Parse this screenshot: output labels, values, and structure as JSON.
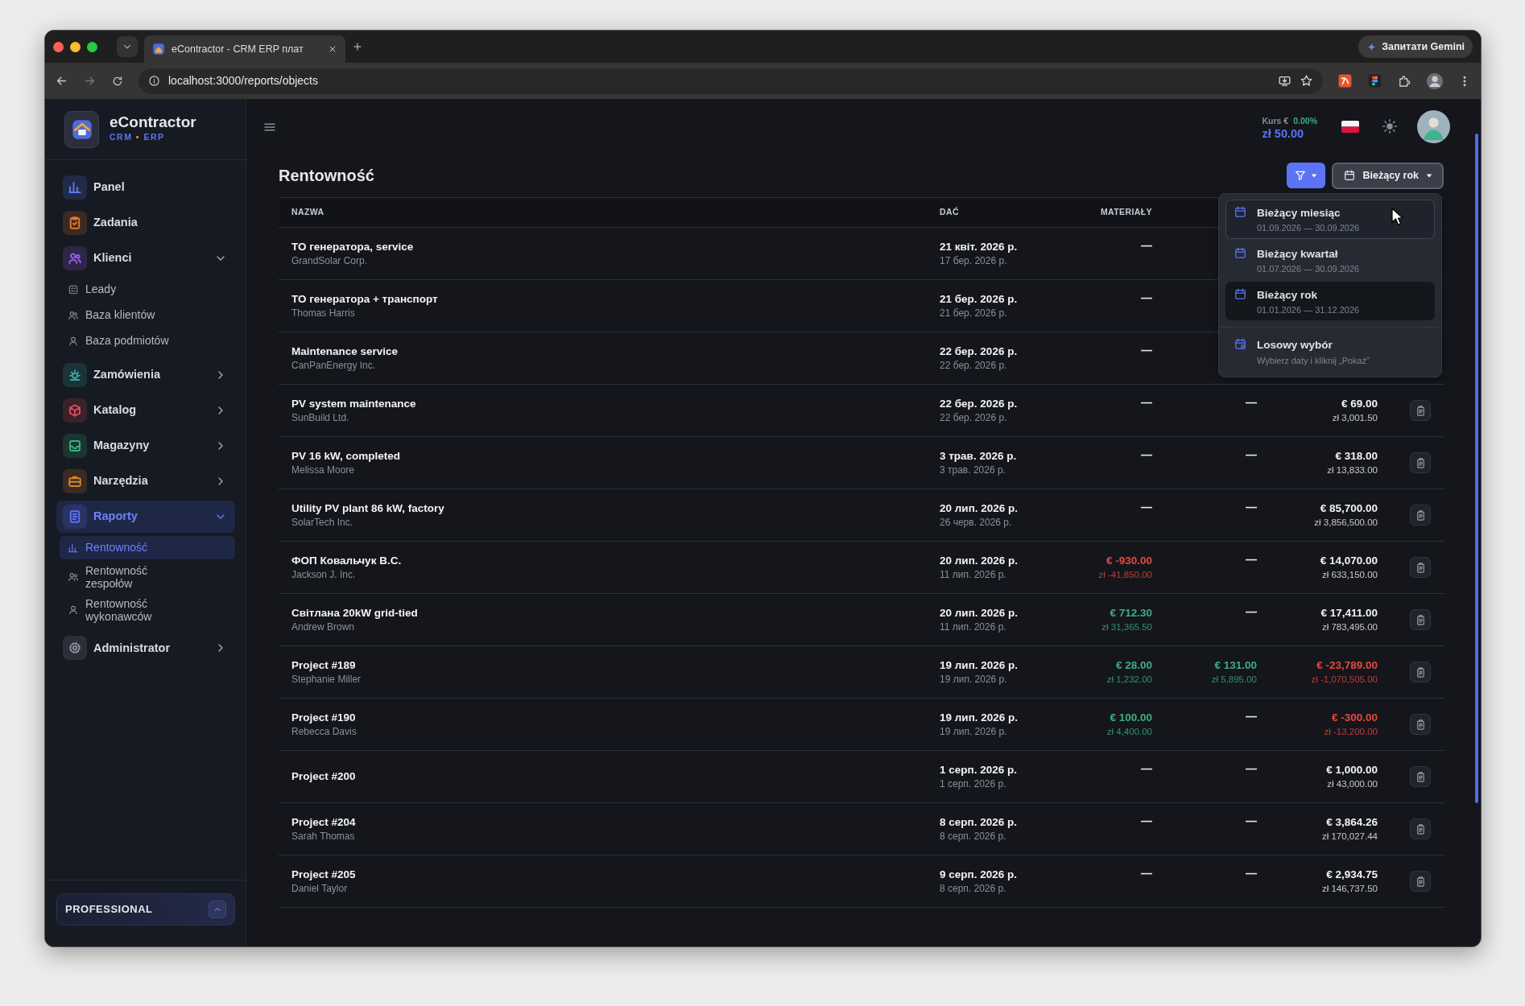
{
  "browser": {
    "tab_title": "eContractor - CRM ERP плат",
    "address": "localhost:3000/reports/objects",
    "gemini": "Запитати Gemini"
  },
  "brand": {
    "name": "eContractor",
    "tagline": [
      "CRM",
      "•",
      "ERP"
    ]
  },
  "sidebar": {
    "items": [
      {
        "label": "Panel",
        "kind": "link",
        "selected": false,
        "color": "#5b74f5"
      },
      {
        "label": "Zadania",
        "kind": "link",
        "selected": false,
        "color": "#e5762f"
      },
      {
        "label": "Klienci",
        "kind": "group",
        "expanded": true,
        "selected": false,
        "color": "#9a5cf0",
        "children": [
          {
            "label": "Leady",
            "selected": false
          },
          {
            "label": "Baza klientów",
            "selected": false
          },
          {
            "label": "Baza podmiotów",
            "selected": false
          }
        ]
      },
      {
        "label": "Zamówienia",
        "kind": "group",
        "expanded": false,
        "selected": false,
        "color": "#3aa6a6"
      },
      {
        "label": "Katalog",
        "kind": "group",
        "expanded": false,
        "selected": false,
        "color": "#e0485a"
      },
      {
        "label": "Magazyny",
        "kind": "group",
        "expanded": false,
        "selected": false,
        "color": "#35b27a"
      },
      {
        "label": "Narzędzia",
        "kind": "group",
        "expanded": false,
        "selected": false,
        "color": "#d9822b"
      },
      {
        "label": "Raporty",
        "kind": "group",
        "expanded": true,
        "selected": true,
        "color": "#5b74f5",
        "children": [
          {
            "label": "Rentowność",
            "selected": true
          },
          {
            "label": "Rentowność zespołów",
            "selected": false
          },
          {
            "label": "Rentowność wykonawców",
            "selected": false
          }
        ]
      },
      {
        "label": "Administrator",
        "kind": "group",
        "expanded": false,
        "selected": false,
        "color": "#8a8f9c"
      }
    ],
    "plan": "PROFESSIONAL"
  },
  "header": {
    "rate_label": "Kurs €",
    "rate_change": "0.00%",
    "rate_value": "zł 50.00"
  },
  "page": {
    "title": "Rentowność",
    "period_button": "Bieżący rok"
  },
  "period_menu": [
    {
      "label": "Bieżący miesiąc",
      "range": "01.09.2026 — 30.09.2026",
      "selected": false,
      "hovered": true
    },
    {
      "label": "Bieżący kwartał",
      "range": "01.07.2026 — 30.09.2026",
      "selected": false,
      "hovered": false
    },
    {
      "label": "Bieżący rok",
      "range": "01.01.2026 — 31.12.2026",
      "selected": true,
      "hovered": false
    },
    {
      "label": "Losowy wybór",
      "range": "Wybierz daty i kliknij „Pokaż”",
      "selected": false,
      "hovered": false,
      "divider_before": true
    }
  ],
  "table": {
    "columns": [
      "NAZWA",
      "DAĆ",
      "MATERIAŁY"
    ],
    "rows": [
      {
        "name": "ТО генератора, service",
        "client": "GrandSolar Corp.",
        "date": "21 квіт. 2026 р.",
        "date_2": "17 бер. 2026 р.",
        "materials": {
          "kind": "dash",
          "text": "—"
        },
        "report_button": false
      },
      {
        "name": "ТО генератора + транспорт",
        "client": "Thomas Harris",
        "date": "21 бер. 2026 р.",
        "date_2": "21 бер. 2026 р.",
        "materials": {
          "kind": "dash",
          "text": "—"
        },
        "report_button": false
      },
      {
        "name": "Maintenance service",
        "client": "CanPanEnergy Inc.",
        "date": "22 бер. 2026 р.",
        "date_2": "22 бер. 2026 р.",
        "materials": {
          "kind": "dash",
          "text": "—"
        },
        "report_button": false
      },
      {
        "name": "PV system maintenance",
        "client": "SunBuild Ltd.",
        "date": "22 бер. 2026 р.",
        "date_2": "22 бер. 2026 р.",
        "materials": {
          "kind": "dash",
          "text": "—"
        },
        "column_4": {
          "kind": "dash",
          "text": "—"
        },
        "column_5": {
          "kind": "amount",
          "eur": "€ 69.00",
          "pln": "zł 3,001.50",
          "color": "#f0f2f5"
        },
        "report_button": true
      },
      {
        "name": "PV 16 kW, completed",
        "client": "Melissa Moore",
        "date": "3 трав. 2026 р.",
        "date_2": "3 трав. 2026 р.",
        "materials": {
          "kind": "dash",
          "text": "—"
        },
        "column_4": {
          "kind": "dash",
          "text": "—"
        },
        "column_5": {
          "kind": "amount",
          "eur": "€ 318.00",
          "pln": "zł 13,833.00",
          "color": "#f0f2f5"
        },
        "report_button": true
      },
      {
        "name": "Utility PV plant 86 kW, factory",
        "client": "SolarTech Inc.",
        "date": "20 лип. 2026 р.",
        "date_2": "26 черв. 2026 р.",
        "materials": {
          "kind": "dash",
          "text": "—"
        },
        "column_4": {
          "kind": "dash",
          "text": "—"
        },
        "column_5": {
          "kind": "amount",
          "eur": "€ 85,700.00",
          "pln": "zł 3,856,500.00",
          "color": "#f0f2f5"
        },
        "report_button": true
      },
      {
        "name": "ФОП Ковальчук В.С.",
        "client": "Jackson J. Inc.",
        "date": "20 лип. 2026 р.",
        "date_2": "11 лип. 2026 р.",
        "materials": {
          "kind": "amount",
          "eur": "€ -930.00",
          "pln": "zł -41,850.00",
          "color": "#e5483b"
        },
        "column_4": {
          "kind": "dash",
          "text": "—"
        },
        "column_5": {
          "kind": "amount",
          "eur": "€ 14,070.00",
          "pln": "zł 633,150.00",
          "color": "#f0f2f5"
        },
        "report_button": true
      },
      {
        "name": "Світлана 20kW grid-tied",
        "client": "Andrew Brown",
        "date": "20 лип. 2026 р.",
        "date_2": "11 лип. 2026 р.",
        "materials": {
          "kind": "amount",
          "eur": "€ 712.30",
          "pln": "zł 31,365.50",
          "color": "#3fae7f"
        },
        "column_4": {
          "kind": "dash",
          "text": "—"
        },
        "column_5": {
          "kind": "amount",
          "eur": "€ 17,411.00",
          "pln": "zł 783,495.00",
          "color": "#f0f2f5"
        },
        "report_button": true
      },
      {
        "name": "Project #189",
        "client": "Stephanie Miller",
        "date": "19 лип. 2026 р.",
        "date_2": "19 лип. 2026 р.",
        "materials": {
          "kind": "amount",
          "eur": "€ 28.00",
          "pln": "zł 1,232.00",
          "color": "#3fae7f"
        },
        "column_4": {
          "kind": "amount",
          "eur": "€ 131.00",
          "pln": "zł 5,895.00",
          "color": "#3fae7f"
        },
        "column_5": {
          "kind": "amount",
          "eur": "€ -23,789.00",
          "pln": "zł -1,070,505.00",
          "color": "#e5483b"
        },
        "report_button": true
      },
      {
        "name": "Project #190",
        "client": "Rebecca Davis",
        "date": "19 лип. 2026 р.",
        "date_2": "19 лип. 2026 р.",
        "materials": {
          "kind": "amount",
          "eur": "€ 100.00",
          "pln": "zł 4,400.00",
          "color": "#3fae7f"
        },
        "column_4": {
          "kind": "dash",
          "text": "—"
        },
        "column_5": {
          "kind": "amount",
          "eur": "€ -300.00",
          "pln": "zł -13,200.00",
          "color": "#e5483b"
        },
        "report_button": true
      },
      {
        "name": "Project #200",
        "date": "1 серп. 2026 р.",
        "date_2": "1 серп. 2026 р.",
        "materials": {
          "kind": "dash",
          "text": "—"
        },
        "column_4": {
          "kind": "dash",
          "text": "—"
        },
        "column_5": {
          "kind": "amount",
          "eur": "€ 1,000.00",
          "pln": "zł 43,000.00",
          "color": "#f0f2f5"
        },
        "report_button": true
      },
      {
        "name": "Project #204",
        "client": "Sarah Thomas",
        "date": "8 серп. 2026 р.",
        "date_2": "8 серп. 2026 р.",
        "materials": {
          "kind": "dash",
          "text": "—"
        },
        "column_4": {
          "kind": "dash",
          "text": "—"
        },
        "column_5": {
          "kind": "amount",
          "eur": "€ 3,864.26",
          "pln": "zł 170,027.44",
          "color": "#f0f2f5"
        },
        "report_button": true
      },
      {
        "name": "Project #205",
        "client": "Daniel Taylor",
        "date": "9 серп. 2026 р.",
        "date_2": "8 серп. 2026 р.",
        "materials": {
          "kind": "dash",
          "text": "—"
        },
        "column_4": {
          "kind": "dash",
          "text": "—"
        },
        "column_5": {
          "kind": "amount",
          "eur": "€ 2,934.75",
          "pln": "zł 146,737.50",
          "color": "#f0f2f5"
        },
        "report_button": true
      }
    ]
  }
}
